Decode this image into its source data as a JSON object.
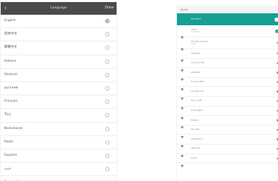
{
  "language": {
    "title": "Language",
    "done_label": "Done",
    "items": [
      {
        "label": "English",
        "selected": true
      },
      {
        "label": "简体中文",
        "selected": false
      },
      {
        "label": "繁體中文",
        "selected": false
      },
      {
        "label": "Italiano",
        "selected": false
      },
      {
        "label": "Deutsch",
        "selected": false
      },
      {
        "label": "русский",
        "selected": false
      },
      {
        "label": "Français",
        "selected": false
      },
      {
        "label": "Türç",
        "selected": false
      },
      {
        "label": "Nederlands",
        "selected": false
      },
      {
        "label": "Polski",
        "selected": false
      },
      {
        "label": "Español",
        "selected": false
      },
      {
        "label": "عربي",
        "selected": false
      },
      {
        "label": "Português",
        "selected": false
      }
    ]
  },
  "wifi": {
    "title": "WLAN",
    "connected_label": "Use Wi-Fi",
    "toggle_on": true,
    "accent_color": "#169f93",
    "networks": [
      {
        "name": "CMCC",
        "sub": "Connected",
        "status": true
      },
      {
        "name": "TP-LINK_5G_8C4A",
        "sub": "Saved",
        "status": false
      },
      {
        "name": "ChinaNet",
        "sub": "",
        "status": false
      },
      {
        "name": "Xiaomi_Guest",
        "sub": "",
        "status": false
      },
      {
        "name": "MERCURY",
        "sub": "",
        "status": false
      },
      {
        "name": "Huawei-Office",
        "sub": "",
        "status": false
      },
      {
        "name": "TP-LINK_C3A",
        "sub": "",
        "status": false
      },
      {
        "name": "FAST_7A4E",
        "sub": "",
        "status": false
      },
      {
        "name": "Tenda_2B10",
        "sub": "",
        "status": false
      },
      {
        "name": "Netgear",
        "sub": "",
        "status": false
      },
      {
        "name": "CU_ka8p",
        "sub": "",
        "status": false
      },
      {
        "name": "ChinaNet-xJ",
        "sub": "",
        "status": false
      },
      {
        "name": "CMCC-Gd",
        "sub": "",
        "status": false
      },
      {
        "name": "Guest",
        "sub": "",
        "status": false
      }
    ]
  }
}
